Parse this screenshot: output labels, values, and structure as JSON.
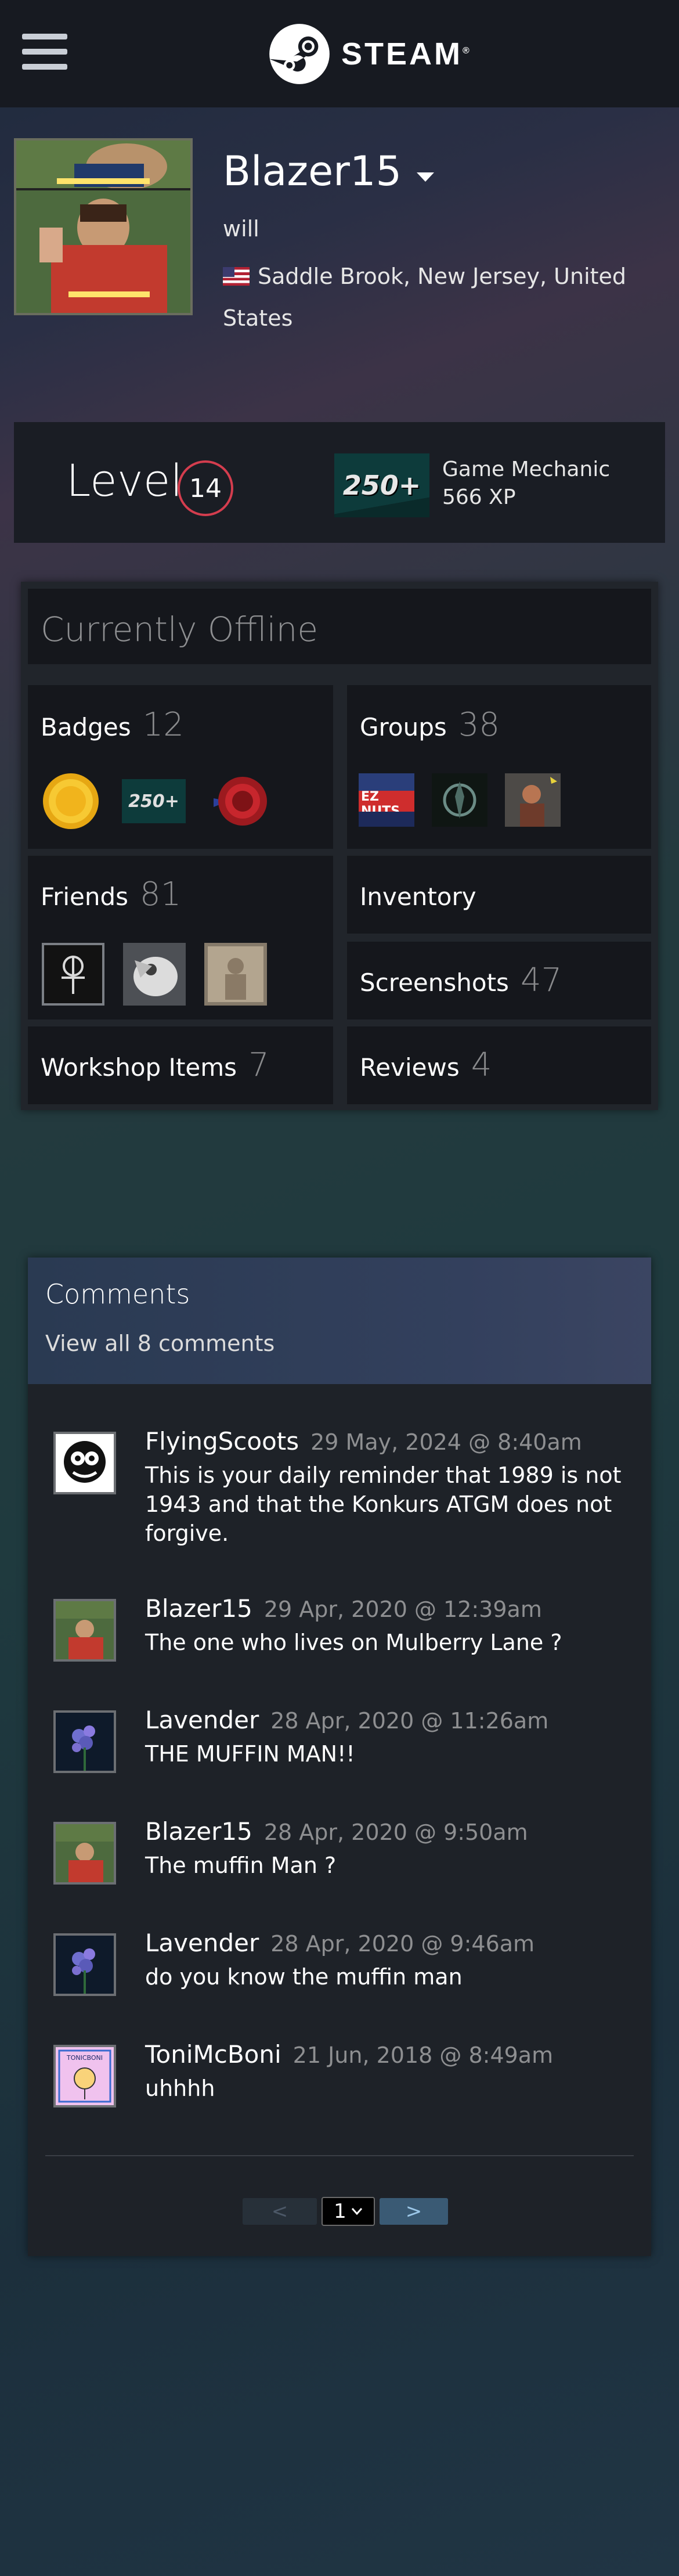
{
  "header": {
    "menu_icon": "hamburger-icon",
    "logo_icon": "steam-logo-icon",
    "logo_text": "STEAM",
    "logo_mark": "®"
  },
  "profile": {
    "name": "Blazer15",
    "real_name": "will",
    "location": "Saddle Brook, New Jersey, United States",
    "flag_icon": "us-flag-icon"
  },
  "level": {
    "label": "Level",
    "value": "14",
    "badge_text": "250+",
    "badge_name": "Game Mechanic",
    "badge_xp": "566 XP"
  },
  "status": "Currently Offline",
  "tiles": {
    "badges": {
      "label": "Badges",
      "count": "12",
      "badge_text": "250+"
    },
    "groups": {
      "label": "Groups",
      "count": "38",
      "group1_text": "EZ NUTS"
    },
    "friends": {
      "label": "Friends",
      "count": "81"
    },
    "inventory": {
      "label": "Inventory"
    },
    "screenshots": {
      "label": "Screenshots",
      "count": "47"
    },
    "workshop": {
      "label": "Workshop Items",
      "count": "7"
    },
    "reviews": {
      "label": "Reviews",
      "count": "4"
    }
  },
  "comments": {
    "title": "Comments",
    "view_all": "View all 8 comments",
    "items": [
      {
        "author": "FlyingScoots",
        "timestamp": "29 May, 2024 @ 8:40am",
        "text": "This is your daily reminder that 1989 is not 1943 and that the Konkurs ATGM does not forgive."
      },
      {
        "author": "Blazer15",
        "timestamp": "29 Apr, 2020 @ 12:39am",
        "text": "The one who lives on Mulberry Lane ?"
      },
      {
        "author": "Lavender",
        "timestamp": "28 Apr, 2020 @ 11:26am",
        "text": "THE MUFFIN MAN!!"
      },
      {
        "author": "Blazer15",
        "timestamp": "28 Apr, 2020 @ 9:50am",
        "text": "The muffin Man ?"
      },
      {
        "author": "Lavender",
        "timestamp": "28 Apr, 2020 @ 9:46am",
        "text": "do you know the muffin man"
      },
      {
        "author": "ToniMcBoni",
        "timestamp": "21 Jun, 2018 @ 8:49am",
        "text": "uhhhh"
      }
    ],
    "avatar_label_toni": "TONICBONI",
    "pager": {
      "prev": "<",
      "page": "1",
      "next": ">"
    }
  },
  "colors": {
    "header_bg": "#171a21",
    "level_ring": "#d43d4e",
    "panel_bg": "#21252b",
    "tile_bg": "#15171c",
    "muted_text": "#8e8f91"
  }
}
